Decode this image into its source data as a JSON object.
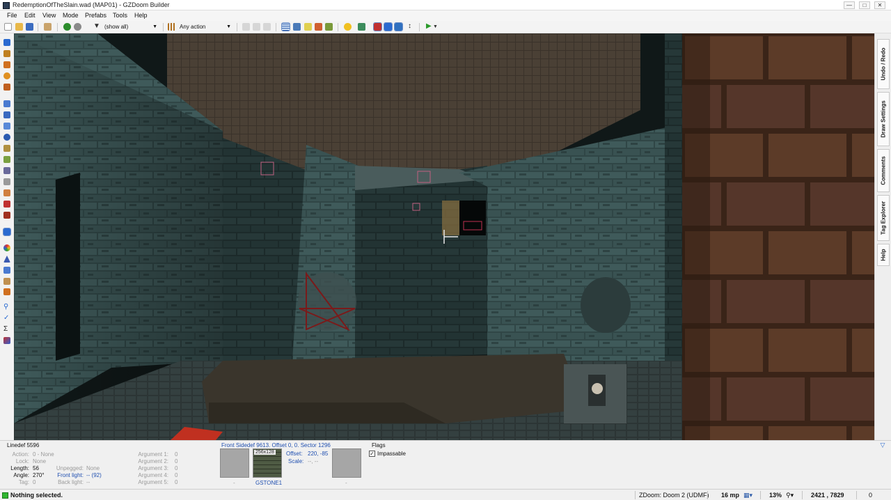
{
  "window": {
    "title": "RedemptionOfTheSlain.wad (MAP01) - GZDoom Builder",
    "controls": [
      "—",
      "□",
      "✕"
    ]
  },
  "menu": [
    "File",
    "Edit",
    "View",
    "Mode",
    "Prefabs",
    "Tools",
    "Help"
  ],
  "toolbar": {
    "filter_value": "(show all)",
    "action_value": "Any action"
  },
  "right_dock": {
    "tabs": [
      "Undo / Redo",
      "Draw Settings",
      "Comments",
      "Tag Explorer",
      "Help"
    ]
  },
  "linedef_info": {
    "heading": "Linedef 5596",
    "action_label": "Action:",
    "action_value": "0 - None",
    "lock_label": "Lock:",
    "lock_value": "None",
    "length_label": "Length:",
    "length_value": "56",
    "angle_label": "Angle:",
    "angle_value": "270°",
    "tag_label": "Tag:",
    "tag_value": "0",
    "unpegged_label": "Unpegged:",
    "unpegged_value": "None",
    "front_light_label": "Front light:",
    "front_light_value": "-- (92)",
    "back_light_label": "Back light:",
    "back_light_value": "--",
    "arguments": [
      {
        "label": "Argument 1:",
        "value": "0"
      },
      {
        "label": "Argument 2:",
        "value": "0"
      },
      {
        "label": "Argument 3:",
        "value": "0"
      },
      {
        "label": "Argument 4:",
        "value": "0"
      },
      {
        "label": "Argument 5:",
        "value": "0"
      }
    ]
  },
  "sidedef_info": {
    "heading": "Front Sidedef 9613. Offset 0, 0. Sector 1296",
    "upper_texture": "-",
    "middle_texture": "GSTONE1",
    "middle_texture_size": "256x128",
    "lower_texture": "-",
    "offset_label": "Offset:",
    "offset_value": "220, -85",
    "scale_label": "Scale:",
    "scale_value": "--, --"
  },
  "flags": {
    "heading": "Flags",
    "items": [
      {
        "label": "Impassable",
        "checked": true
      }
    ]
  },
  "status": {
    "message": "Nothing selected.",
    "engine": "ZDoom: Doom 2 (UDMF)",
    "grid": "16 mp",
    "zoom": "13%",
    "coordinates": "2421 , 7829",
    "last_value": "0"
  },
  "colors": {
    "accent_blue": "#1f4fb0",
    "status_green": "#2fb52f"
  }
}
